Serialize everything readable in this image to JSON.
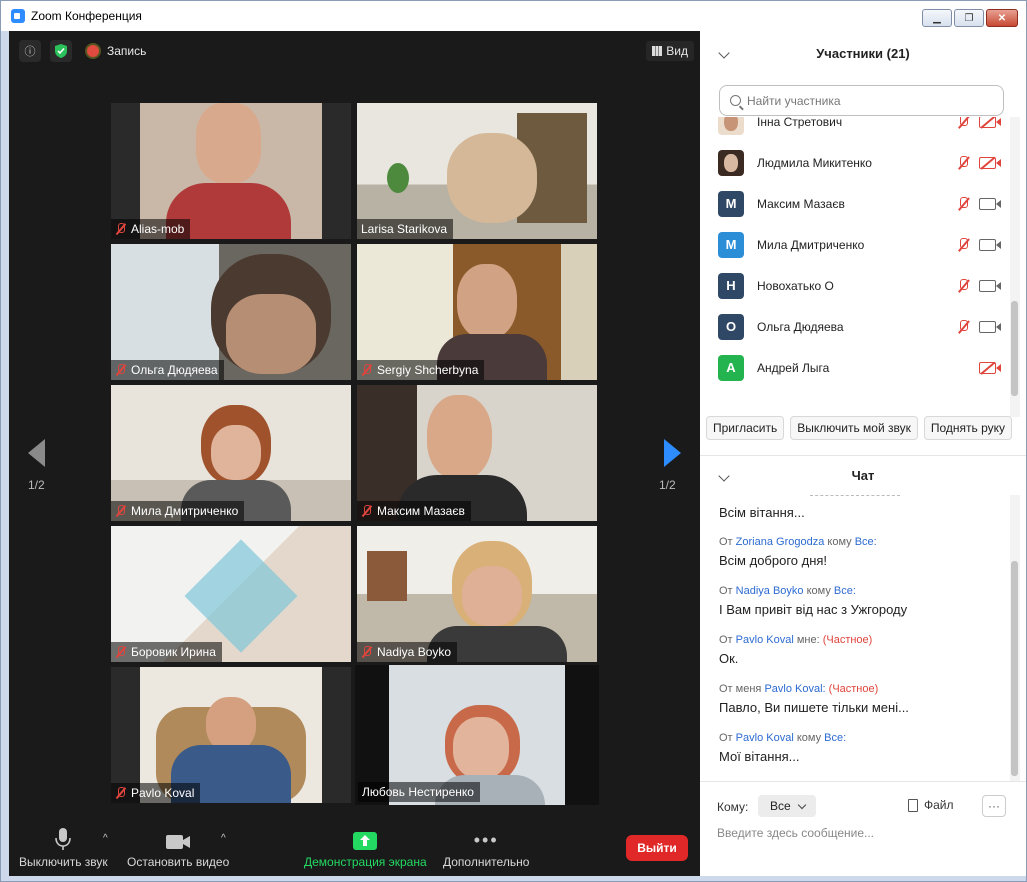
{
  "window": {
    "title": "Zoom Конференция"
  },
  "topbar": {
    "record_label": "Запись",
    "view_label": "Вид"
  },
  "gallery": {
    "page_left": "1/2",
    "page_right": "1/2",
    "tiles": [
      {
        "name": "Alias-mob"
      },
      {
        "name": "Larisa Starikova"
      },
      {
        "name": "Ольга Дюдяева"
      },
      {
        "name": "Sergiy Shcherbyna"
      },
      {
        "name": "Мила Дмитриченко"
      },
      {
        "name": "Максим Мазаєв"
      },
      {
        "name": "Боровик Ирина"
      },
      {
        "name": "Nadiya Boyko"
      },
      {
        "name": "Pavlo Koval"
      },
      {
        "name": "Любовь Нестиренко"
      }
    ]
  },
  "toolbar": {
    "mute_label": "Выключить звук",
    "video_label": "Остановить видео",
    "share_label": "Демонстрация экрана",
    "more_label": "Дополнительно",
    "leave_label": "Выйти"
  },
  "participants": {
    "header": "Участники (21)",
    "search_placeholder": "Найти участника",
    "list": [
      {
        "name": "Інна Стретович",
        "avatar_letter": "",
        "avatar_color": "#e8d5c8",
        "mic_muted": true,
        "video_off": true
      },
      {
        "name": "Людмила Микитенко",
        "avatar_letter": "",
        "avatar_color": "#6b4a3a",
        "mic_muted": true,
        "video_off": true
      },
      {
        "name": "Максим Мазаєв",
        "avatar_letter": "M",
        "avatar_color": "#2f4865",
        "mic_muted": true,
        "video_off": false
      },
      {
        "name": "Мила Дмитриченко",
        "avatar_letter": "M",
        "avatar_color": "#2d8ed8",
        "mic_muted": true,
        "video_off": false
      },
      {
        "name": "Новохатько О",
        "avatar_letter": "H",
        "avatar_color": "#2f4865",
        "mic_muted": true,
        "video_off": false
      },
      {
        "name": "Ольга Дюдяева",
        "avatar_letter": "O",
        "avatar_color": "#2f4865",
        "mic_muted": true,
        "video_off": false
      },
      {
        "name": "Андрей Лыга",
        "avatar_letter": "A",
        "avatar_color": "#23b44f",
        "mic_muted": false,
        "video_off": true
      }
    ],
    "actions": {
      "invite": "Пригласить",
      "mute_me": "Выключить мой звук",
      "raise_hand": "Поднять руку"
    }
  },
  "chat": {
    "header": "Чат",
    "messages": [
      {
        "from_prefix": "",
        "from": "",
        "mid": "",
        "to": "",
        "private": "",
        "text": "Всім вітання..."
      },
      {
        "from_prefix": "От",
        "from": "Zoriana Grogodza",
        "mid": "кому",
        "to": "Все:",
        "private": "",
        "text": "Всім доброго дня!"
      },
      {
        "from_prefix": "От",
        "from": "Nadiya Boyko",
        "mid": "кому",
        "to": "Все:",
        "private": "",
        "text": "І Вам привіт від нас з Ужгороду"
      },
      {
        "from_prefix": "От",
        "from": "Pavlo Koval",
        "mid": "мне:",
        "to": "",
        "private": "(Частное)",
        "text": "Ок."
      },
      {
        "from_prefix": "От меня",
        "from": "Pavlo Koval:",
        "mid": "",
        "to": "",
        "private": "(Частное)",
        "text": "Павло, Ви пишете тільки мені..."
      },
      {
        "from_prefix": "От",
        "from": "Pavlo Koval",
        "mid": "кому",
        "to": "Все:",
        "private": "",
        "text": "Мої вітання..."
      }
    ],
    "to_label": "Кому:",
    "to_value": "Все",
    "file_label": "Файл",
    "input_placeholder": "Введите здесь сообщение..."
  },
  "colors": {
    "accent": "#2d8cff",
    "share_green": "#23d962",
    "leave_red": "#e02828",
    "active_speaker": "#f2f27a"
  }
}
